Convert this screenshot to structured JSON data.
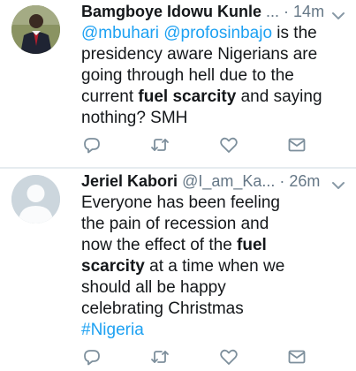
{
  "tweets": [
    {
      "author": {
        "name": "Bamgboye Idowu Kunle",
        "handle": "...",
        "sep": " · ",
        "time": "14m",
        "avatar": "profile-photo"
      },
      "body": {
        "line1_m1": "@mbuhari",
        "line1_m2": "@profosinbajo",
        "line1_rest": " is the",
        "line2": "presidency aware Nigerians are",
        "line3": "going through hell due to the",
        "line4_a": "current ",
        "line4_bold": "fuel scarcity",
        "line4_b": " and saying",
        "line5": "nothing? SMH"
      },
      "actions": [
        "reply-icon",
        "retweet-icon",
        "like-icon",
        "direct-message-icon"
      ]
    },
    {
      "author": {
        "name": "Jeriel Kabori",
        "handle": "@I_am_Ka...",
        "sep": " · ",
        "time": "26m",
        "avatar": "default-avatar"
      },
      "body": {
        "line1": "Everyone has been feeling",
        "line2": "the pain of recession and",
        "line3_a": "now the effect of the ",
        "line3_bold": "fuel",
        "line4_bold": "scarcity",
        "line4_b": " at a time when we",
        "line5": "should all be happy",
        "line6": "celebrating Christmas",
        "hashtag": "#Nigeria"
      },
      "actions": [
        "reply-icon",
        "retweet-icon",
        "like-icon",
        "direct-message-icon"
      ]
    }
  ],
  "colors": {
    "link": "#1da1f2",
    "text": "#14171a",
    "muted": "#657786",
    "divider": "#e6ecf0"
  }
}
